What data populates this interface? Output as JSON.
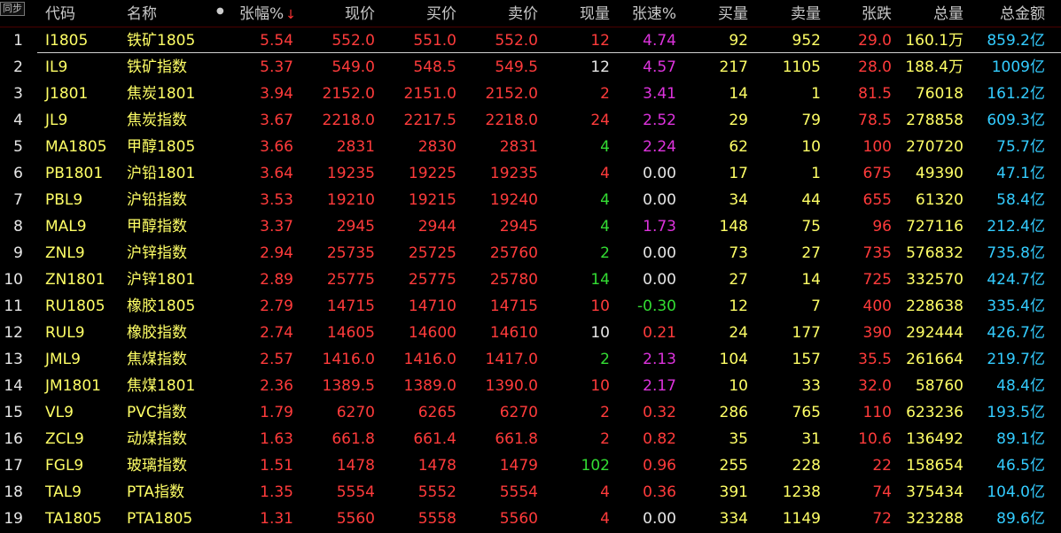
{
  "tab_label": "同步",
  "columns": {
    "code": "代码",
    "name": "名称",
    "change_pct": "张幅%",
    "last": "现价",
    "bid": "买价",
    "ask": "卖价",
    "volume": "现量",
    "speed": "张速%",
    "bid_vol": "买量",
    "ask_vol": "卖量",
    "change": "张跌",
    "total_vol": "总量",
    "total_amt": "总金额"
  },
  "sort_indicator": "↓",
  "colors": {
    "up": "#ff3b3b",
    "yellow": "#ffff66",
    "green": "#33dd33",
    "magenta": "#dd33dd",
    "cyan": "#33ccff"
  },
  "rows": [
    {
      "idx": "1",
      "code": "I1805",
      "name": "铁矿1805",
      "chg": "5.54",
      "last": "552.0",
      "bid": "551.0",
      "ask": "552.0",
      "vol": "12",
      "vol_c": "red",
      "spd": "4.74",
      "spd_c": "mag",
      "bv": "92",
      "av": "952",
      "up": "29.0",
      "tv": "160.1万",
      "amt": "859.2亿"
    },
    {
      "idx": "2",
      "code": "IL9",
      "name": "铁矿指数",
      "chg": "5.37",
      "last": "549.0",
      "bid": "548.5",
      "ask": "549.5",
      "vol": "12",
      "vol_c": "wht",
      "spd": "4.57",
      "spd_c": "mag",
      "bv": "217",
      "av": "1105",
      "up": "28.0",
      "tv": "188.4万",
      "amt": "1009亿"
    },
    {
      "idx": "3",
      "code": "J1801",
      "name": "焦炭1801",
      "chg": "3.94",
      "last": "2152.0",
      "bid": "2151.0",
      "ask": "2152.0",
      "vol": "2",
      "vol_c": "red",
      "spd": "3.41",
      "spd_c": "mag",
      "bv": "14",
      "av": "1",
      "up": "81.5",
      "tv": "76018",
      "amt": "161.2亿"
    },
    {
      "idx": "4",
      "code": "JL9",
      "name": "焦炭指数",
      "chg": "3.67",
      "last": "2218.0",
      "bid": "2217.5",
      "ask": "2218.0",
      "vol": "24",
      "vol_c": "red",
      "spd": "2.52",
      "spd_c": "mag",
      "bv": "29",
      "av": "79",
      "up": "78.5",
      "tv": "278858",
      "amt": "609.3亿"
    },
    {
      "idx": "5",
      "code": "MA1805",
      "name": "甲醇1805",
      "chg": "3.66",
      "last": "2831",
      "bid": "2830",
      "ask": "2831",
      "vol": "4",
      "vol_c": "grn",
      "spd": "2.24",
      "spd_c": "mag",
      "bv": "62",
      "av": "10",
      "up": "100",
      "tv": "270720",
      "amt": "75.7亿"
    },
    {
      "idx": "6",
      "code": "PB1801",
      "name": "沪铅1801",
      "chg": "3.64",
      "last": "19235",
      "bid": "19225",
      "ask": "19235",
      "vol": "4",
      "vol_c": "red",
      "spd": "0.00",
      "spd_c": "wht",
      "bv": "17",
      "av": "1",
      "up": "675",
      "tv": "49390",
      "amt": "47.1亿"
    },
    {
      "idx": "7",
      "code": "PBL9",
      "name": "沪铅指数",
      "chg": "3.53",
      "last": "19210",
      "bid": "19215",
      "ask": "19240",
      "vol": "4",
      "vol_c": "grn",
      "spd": "0.00",
      "spd_c": "wht",
      "bv": "34",
      "av": "44",
      "up": "655",
      "tv": "61320",
      "amt": "58.4亿"
    },
    {
      "idx": "8",
      "code": "MAL9",
      "name": "甲醇指数",
      "chg": "3.37",
      "last": "2945",
      "bid": "2944",
      "ask": "2945",
      "vol": "4",
      "vol_c": "grn",
      "spd": "1.73",
      "spd_c": "mag",
      "bv": "148",
      "av": "75",
      "up": "96",
      "tv": "727116",
      "amt": "212.4亿"
    },
    {
      "idx": "9",
      "code": "ZNL9",
      "name": "沪锌指数",
      "chg": "2.94",
      "last": "25735",
      "bid": "25725",
      "ask": "25760",
      "vol": "2",
      "vol_c": "grn",
      "spd": "0.00",
      "spd_c": "wht",
      "bv": "73",
      "av": "27",
      "up": "735",
      "tv": "576832",
      "amt": "735.8亿"
    },
    {
      "idx": "10",
      "code": "ZN1801",
      "name": "沪锌1801",
      "chg": "2.89",
      "last": "25775",
      "bid": "25775",
      "ask": "25780",
      "vol": "14",
      "vol_c": "grn",
      "spd": "0.00",
      "spd_c": "wht",
      "bv": "27",
      "av": "14",
      "up": "725",
      "tv": "332570",
      "amt": "424.7亿"
    },
    {
      "idx": "11",
      "code": "RU1805",
      "name": "橡胶1805",
      "chg": "2.79",
      "last": "14715",
      "bid": "14710",
      "ask": "14715",
      "vol": "10",
      "vol_c": "red",
      "spd": "-0.30",
      "spd_c": "grn",
      "bv": "12",
      "av": "7",
      "up": "400",
      "tv": "228638",
      "amt": "335.4亿"
    },
    {
      "idx": "12",
      "code": "RUL9",
      "name": "橡胶指数",
      "chg": "2.74",
      "last": "14605",
      "bid": "14600",
      "ask": "14610",
      "vol": "10",
      "vol_c": "wht",
      "spd": "0.21",
      "spd_c": "red",
      "bv": "24",
      "av": "177",
      "up": "390",
      "tv": "292444",
      "amt": "426.7亿"
    },
    {
      "idx": "13",
      "code": "JML9",
      "name": "焦煤指数",
      "chg": "2.57",
      "last": "1416.0",
      "bid": "1416.0",
      "ask": "1417.0",
      "vol": "2",
      "vol_c": "grn",
      "spd": "2.13",
      "spd_c": "mag",
      "bv": "104",
      "av": "157",
      "up": "35.5",
      "tv": "261664",
      "amt": "219.7亿"
    },
    {
      "idx": "14",
      "code": "JM1801",
      "name": "焦煤1801",
      "chg": "2.36",
      "last": "1389.5",
      "bid": "1389.0",
      "ask": "1390.0",
      "vol": "10",
      "vol_c": "red",
      "spd": "2.17",
      "spd_c": "mag",
      "bv": "10",
      "av": "33",
      "up": "32.0",
      "tv": "58760",
      "amt": "48.4亿"
    },
    {
      "idx": "15",
      "code": "VL9",
      "name": "PVC指数",
      "chg": "1.79",
      "last": "6270",
      "bid": "6265",
      "ask": "6270",
      "vol": "2",
      "vol_c": "red",
      "spd": "0.32",
      "spd_c": "red",
      "bv": "286",
      "av": "765",
      "up": "110",
      "tv": "623236",
      "amt": "193.5亿"
    },
    {
      "idx": "16",
      "code": "ZCL9",
      "name": "动煤指数",
      "chg": "1.63",
      "last": "661.8",
      "bid": "661.4",
      "ask": "661.8",
      "vol": "2",
      "vol_c": "red",
      "spd": "0.82",
      "spd_c": "red",
      "bv": "35",
      "av": "31",
      "up": "10.6",
      "tv": "136492",
      "amt": "89.1亿"
    },
    {
      "idx": "17",
      "code": "FGL9",
      "name": "玻璃指数",
      "chg": "1.51",
      "last": "1478",
      "bid": "1478",
      "ask": "1479",
      "vol": "102",
      "vol_c": "grn",
      "spd": "0.96",
      "spd_c": "red",
      "bv": "255",
      "av": "228",
      "up": "22",
      "tv": "158654",
      "amt": "46.5亿"
    },
    {
      "idx": "18",
      "code": "TAL9",
      "name": "PTA指数",
      "chg": "1.35",
      "last": "5554",
      "bid": "5552",
      "ask": "5554",
      "vol": "4",
      "vol_c": "red",
      "spd": "0.36",
      "spd_c": "red",
      "bv": "391",
      "av": "1238",
      "up": "74",
      "tv": "375434",
      "amt": "104.0亿"
    },
    {
      "idx": "19",
      "code": "TA1805",
      "name": "PTA1805",
      "chg": "1.31",
      "last": "5560",
      "bid": "5558",
      "ask": "5560",
      "vol": "4",
      "vol_c": "red",
      "spd": "0.00",
      "spd_c": "wht",
      "bv": "334",
      "av": "1149",
      "up": "72",
      "tv": "323288",
      "amt": "89.6亿"
    }
  ]
}
